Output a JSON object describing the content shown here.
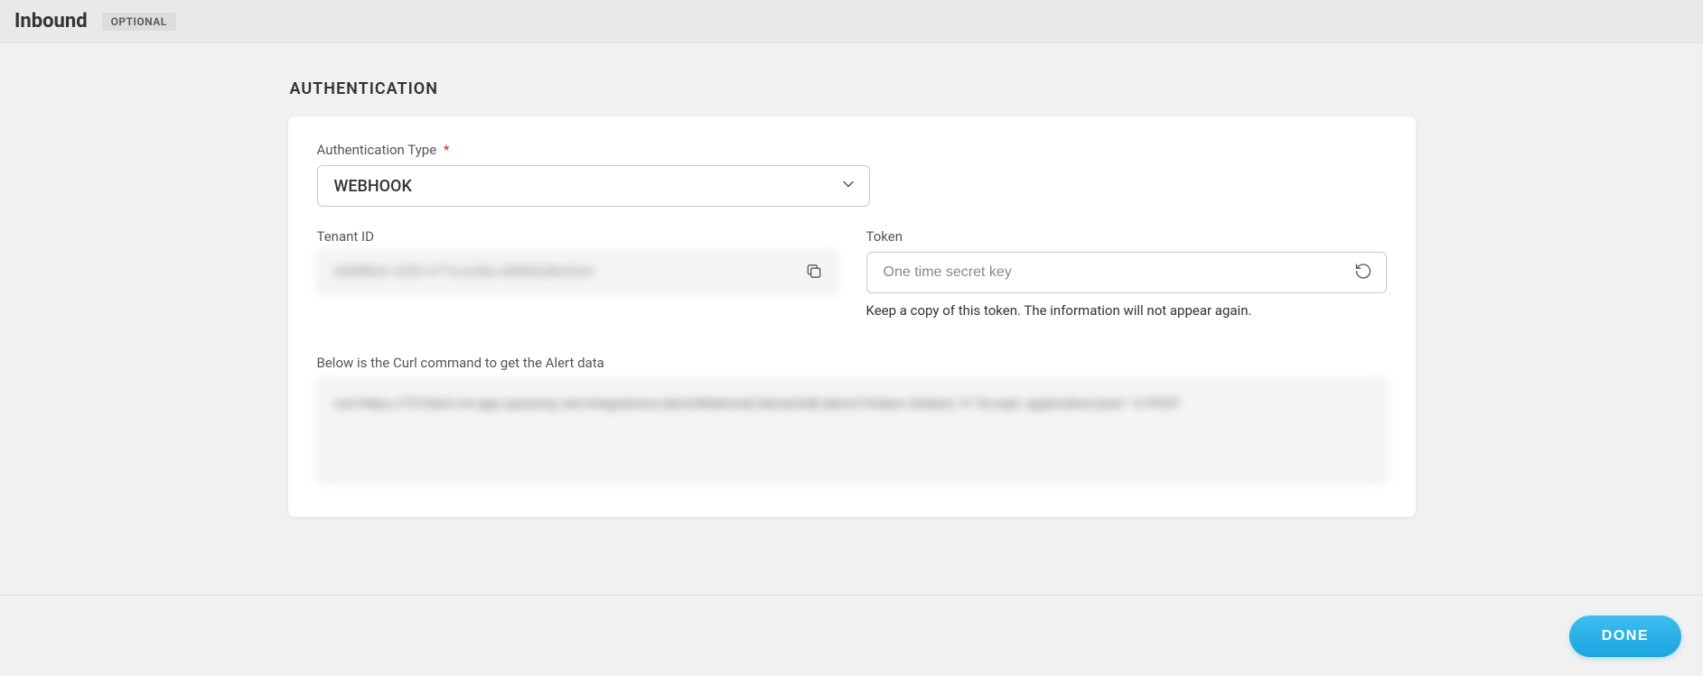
{
  "header": {
    "title": "Inbound",
    "badge": "OPTIONAL"
  },
  "section": {
    "heading": "AUTHENTICATION"
  },
  "auth": {
    "type_label": "Authentication Type",
    "type_value": "WEBHOOK",
    "tenant_label": "Tenant ID",
    "tenant_value": "0d9ff8eh-52f3-477a-b36a-89965d8c62ef",
    "token_label": "Token",
    "token_placeholder": "One time secret key",
    "token_help": "Keep a copy of this token. The information will not appear again.",
    "curl_label": "Below is the Curl command to get the Alert data",
    "curl_value": "curl https://TCClient.int-app.opsramp.net/integrations/alertsWebhook/{tenantId}/alerts?vtoken={token} -H \"Accept: application/json\" -X POST"
  },
  "footer": {
    "done_label": "DONE"
  }
}
